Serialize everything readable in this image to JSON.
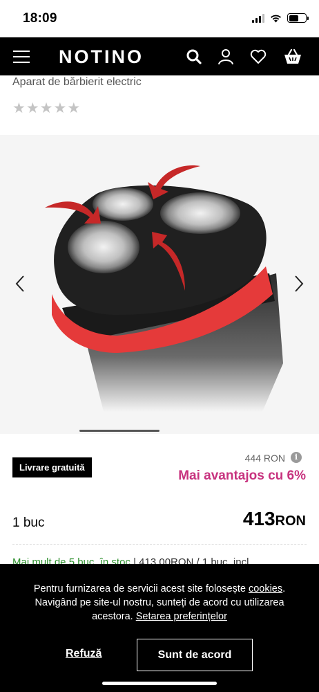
{
  "status_bar": {
    "time": "18:09"
  },
  "header": {
    "logo": "NOTINO",
    "icons": [
      "menu-icon",
      "search-icon",
      "user-icon",
      "heart-icon",
      "basket-icon"
    ]
  },
  "product": {
    "subtitle": "Aparat de bărbierit electric",
    "rating_stars": "★★★★★",
    "rating": 0
  },
  "gallery": {
    "prev_icon": "chevron-left-icon",
    "next_icon": "chevron-right-icon"
  },
  "pricing": {
    "free_delivery": "Livrare gratuită",
    "old_price": "444 RON",
    "info_glyph": "i",
    "discount": "Mai avantajos cu 6%",
    "quantity": "1 buc",
    "price_value": "413",
    "price_currency": "RON",
    "stock_green": "Mai mult de 5 buc. în stoc",
    "stock_rest": " | 413,00RON / 1 buc. incl."
  },
  "cookie_banner": {
    "text_1": "Pentru furnizarea de servicii acest site folosește ",
    "cookies_link": "cookies",
    "text_2": ". Navigând pe site-ul nostru, sunteți de acord cu utilizarea acestora. ",
    "preferences_link": "Setarea preferințelor",
    "refuse": "Refuză",
    "accept": "Sunt de acord"
  },
  "colors": {
    "header_bg": "#000000",
    "accent_pink": "#c7327e",
    "stock_green": "#2c8f2c"
  }
}
